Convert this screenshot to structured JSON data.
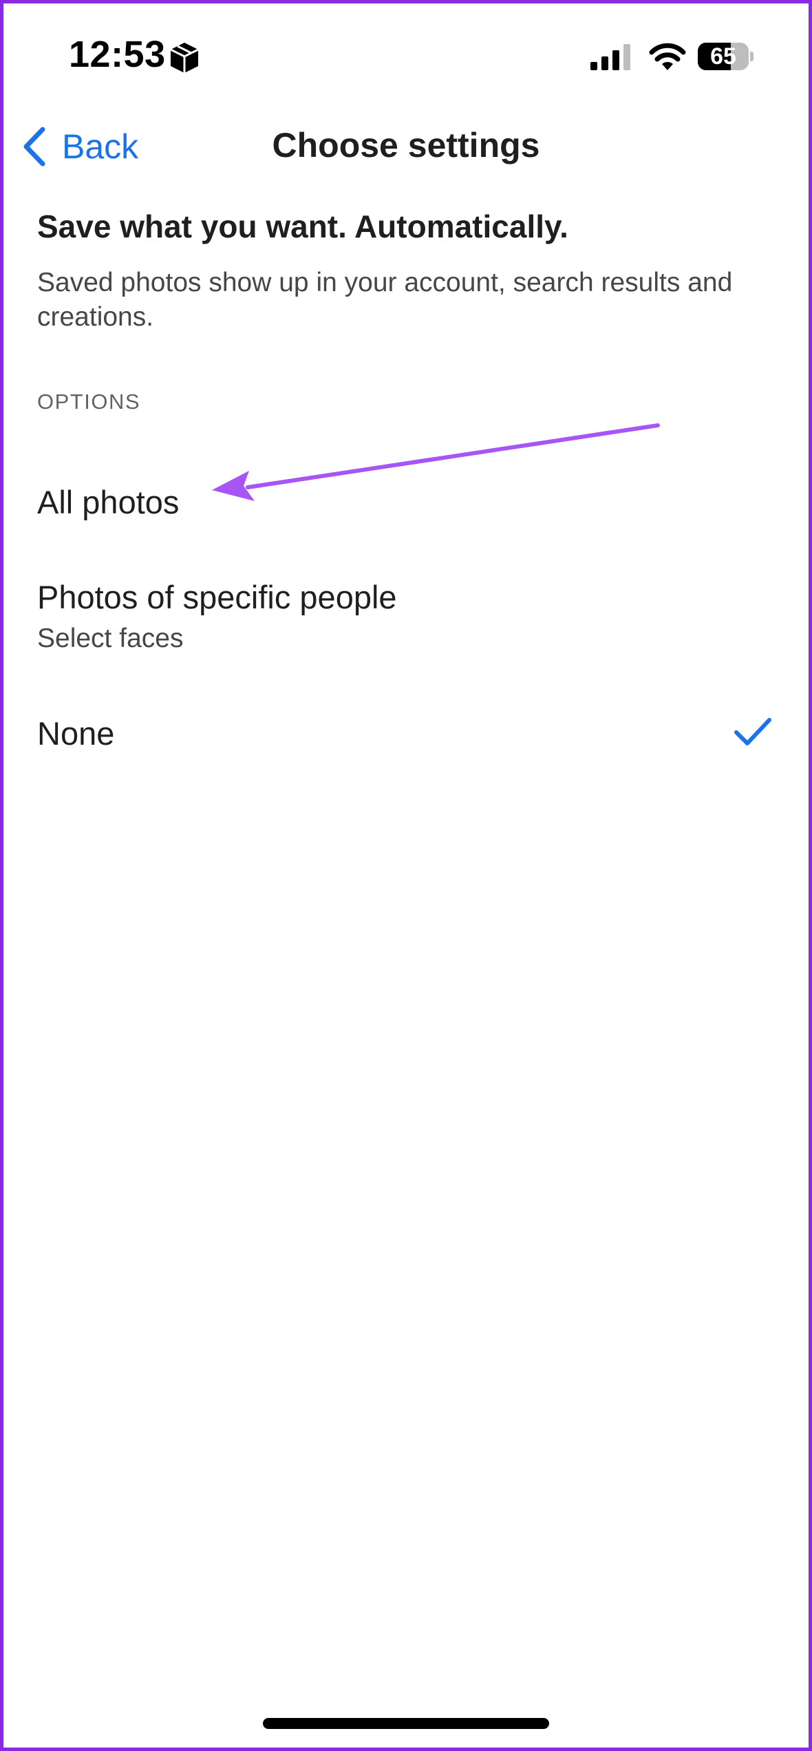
{
  "status_bar": {
    "time": "12:53",
    "battery_level": "65",
    "battery_fraction": 0.65
  },
  "nav": {
    "back_label": "Back",
    "title": "Choose settings"
  },
  "content": {
    "headline": "Save what you want. Automatically.",
    "description": "Saved photos show up in your account, search results and creations.",
    "section_label": "OPTIONS"
  },
  "options": [
    {
      "title": "All photos",
      "subtitle": "",
      "selected": false
    },
    {
      "title": "Photos of specific people",
      "subtitle": "Select faces",
      "selected": false
    },
    {
      "title": "None",
      "subtitle": "",
      "selected": true
    }
  ],
  "colors": {
    "accent": "#1a73e8",
    "annotation": "#a855f7",
    "frame": "#8a2be2"
  },
  "icons": {
    "back": "chevron-left-icon",
    "selected": "checkmark-icon",
    "status": [
      "box-icon",
      "signal-icon",
      "wifi-icon",
      "battery-icon"
    ]
  }
}
